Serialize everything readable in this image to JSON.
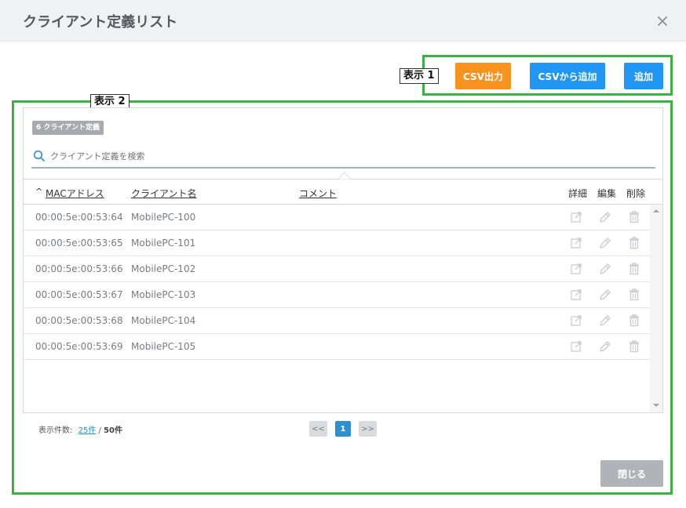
{
  "header": {
    "title": "クライアント定義リスト"
  },
  "annotations": {
    "label1": "表示 1",
    "label2": "表示 2",
    "color": "#3cb043"
  },
  "toolbar": {
    "csv_export_label": "CSV出力",
    "csv_import_label": "CSVから追加",
    "add_label": "追加"
  },
  "panel": {
    "count_badge": "6 クライアント定義",
    "search_placeholder": "クライアント定義を検索"
  },
  "table": {
    "columns": {
      "mac": "MACアドレス",
      "client": "クライアント名",
      "comment": "コメント",
      "detail": "詳細",
      "edit": "編集",
      "delete": "削除"
    },
    "rows": [
      {
        "mac": "00:00:5e:00:53:64",
        "client": "MobilePC-100",
        "comment": ""
      },
      {
        "mac": "00:00:5e:00:53:65",
        "client": "MobilePC-101",
        "comment": ""
      },
      {
        "mac": "00:00:5e:00:53:66",
        "client": "MobilePC-102",
        "comment": ""
      },
      {
        "mac": "00:00:5e:00:53:67",
        "client": "MobilePC-103",
        "comment": ""
      },
      {
        "mac": "00:00:5e:00:53:68",
        "client": "MobilePC-104",
        "comment": ""
      },
      {
        "mac": "00:00:5e:00:53:69",
        "client": "MobilePC-105",
        "comment": ""
      }
    ]
  },
  "footer": {
    "count_label": "表示件数:",
    "per_page": "25件",
    "separator": " / ",
    "total": "50件",
    "prev": "<<",
    "current_page": "1",
    "next": ">>",
    "close_label": "閉じる"
  },
  "colors": {
    "orange": "#f7931e",
    "blue": "#2196f3",
    "page_current": "#2e8fd1"
  }
}
